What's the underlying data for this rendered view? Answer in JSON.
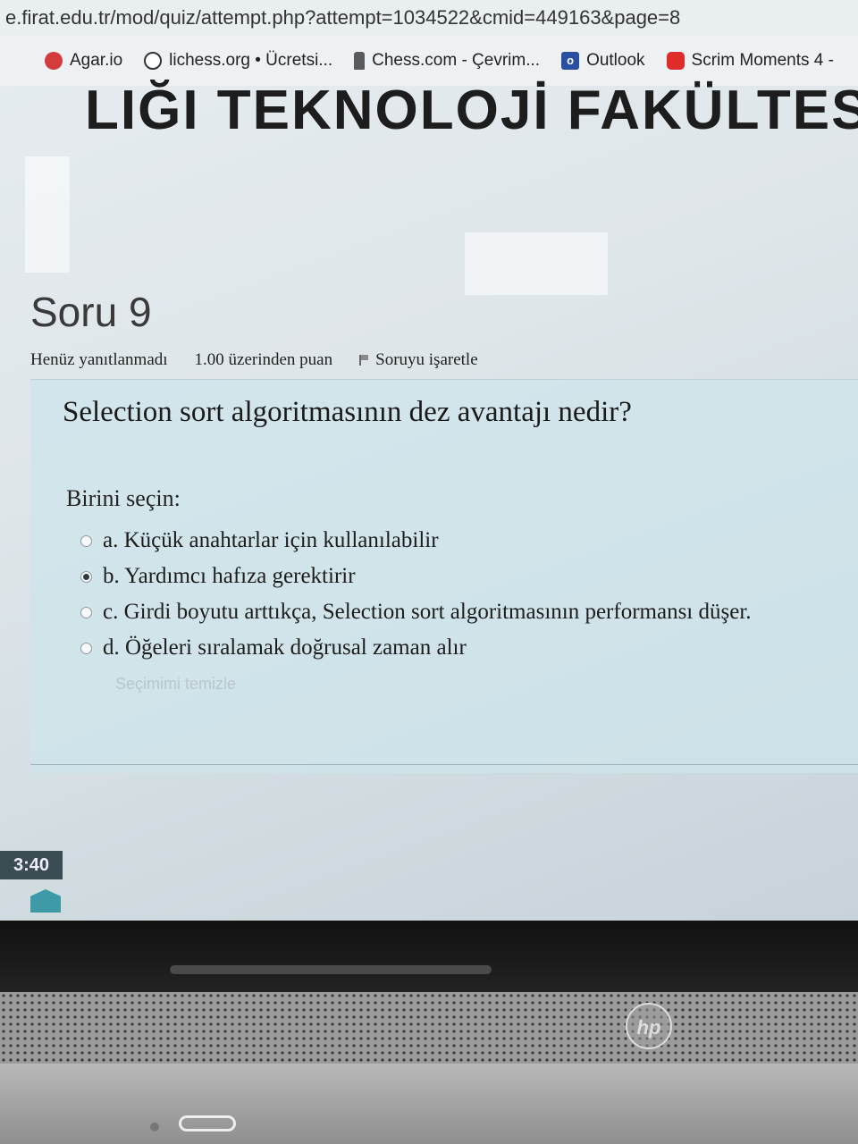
{
  "browser": {
    "url": "e.firat.edu.tr/mod/quiz/attempt.php?attempt=1034522&cmid=449163&page=8",
    "bookmarks": [
      {
        "label": "Agar.io",
        "icon": "agar-icon"
      },
      {
        "label": "lichess.org • Ücretsi...",
        "icon": "lichess-icon"
      },
      {
        "label": "Chess.com - Çevrim...",
        "icon": "chess-pawn-icon"
      },
      {
        "label": "Outlook",
        "icon": "outlook-icon"
      },
      {
        "label": "Scrim Moments 4 -",
        "icon": "youtube-icon"
      }
    ]
  },
  "site": {
    "faculty_banner": "LIĞI TEKNOLOJİ FAKÜLTESİ"
  },
  "question": {
    "number_label": "Soru 9",
    "status": "Henüz yanıtlanmadı",
    "points": "1.00 üzerinden puan",
    "flag_label": "Soruyu işaretle",
    "text": "Selection sort algoritmasının dez avantajı nedir?",
    "prompt": "Birini seçin:",
    "options": [
      {
        "label": "a. Küçük anahtarlar için kullanılabilir",
        "selected": false
      },
      {
        "label": "b. Yardımcı hafıza gerektirir",
        "selected": true
      },
      {
        "label": "c. Girdi boyutu arttıkça, Selection sort algoritmasının performansı düşer.",
        "selected": false
      },
      {
        "label": "d. Öğeleri sıralamak doğrusal zaman alır",
        "selected": false
      }
    ],
    "clear_choice": "Seçimimi temizle"
  },
  "taskbar": {
    "clock": "3:40"
  },
  "device": {
    "brand": "hp"
  }
}
